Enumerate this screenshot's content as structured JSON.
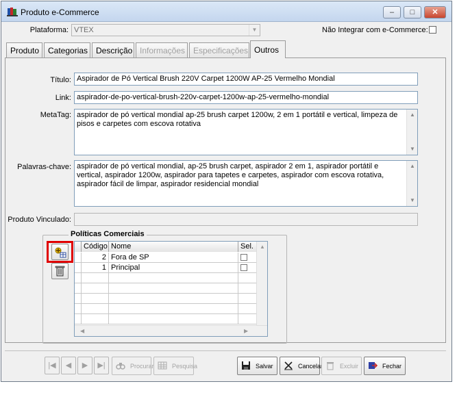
{
  "window": {
    "title": "Produto e-Commerce",
    "minimize": "–",
    "maximize": "□",
    "close": "✕"
  },
  "header": {
    "platform_label": "Plataforma:",
    "platform_value": "VTEX",
    "no_integrate_label": "Não Integrar com e-Commerce:",
    "no_integrate_checked": false
  },
  "tabs": [
    {
      "label": "Produto",
      "state": "normal"
    },
    {
      "label": "Categorias",
      "state": "normal"
    },
    {
      "label": "Descrição",
      "state": "normal"
    },
    {
      "label": "Informações",
      "state": "disabled"
    },
    {
      "label": "Especificações",
      "state": "disabled"
    },
    {
      "label": "Outros",
      "state": "active"
    }
  ],
  "form": {
    "title_label": "Título:",
    "title_value": "Aspirador de Pó Vertical Brush 220V Carpet 1200W AP-25 Vermelho Mondial",
    "link_label": "Link:",
    "link_value": "aspirador-de-po-vertical-brush-220v-carpet-1200w-ap-25-vermelho-mondial",
    "metatag_label": "MetaTag:",
    "metatag_value": "aspirador de pó vertical mondial ap-25 brush carpet 1200w, 2 em 1 portátil e vertical, limpeza de pisos e carpetes com escova rotativa",
    "keywords_label": "Palavras-chave:",
    "keywords_value": "aspirador de pó vertical mondial, ap-25 brush carpet, aspirador 2 em 1, aspirador portátil e vertical, aspirador 1200w, aspirador para tapetes e carpetes, aspirador com escova rotativa, aspirador fácil de limpar, aspirador residencial mondial",
    "linked_product_label": "Produto Vinculado:",
    "linked_product_value": ""
  },
  "policies": {
    "group_title": "Políticas Comerciais",
    "columns": {
      "code": "Código",
      "name": "Nome",
      "sel": "Sel."
    },
    "rows": [
      {
        "code": "2",
        "name": "Fora de SP",
        "sel": false
      },
      {
        "code": "1",
        "name": "Principal",
        "sel": false
      }
    ]
  },
  "toolbar": {
    "first": "|◀",
    "prev": "◀",
    "next": "▶",
    "last": "▶|",
    "search": "Procurar",
    "research": "Pesquisa",
    "save": "Salvar",
    "cancel": "Cancelar",
    "delete": "Excluir",
    "close": "Fechar"
  },
  "colors": {
    "highlight": "#e00000"
  }
}
